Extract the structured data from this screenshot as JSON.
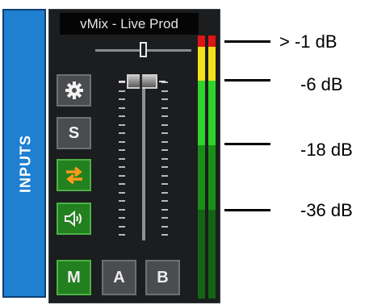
{
  "side_tab": {
    "label": "INPUTS"
  },
  "panel": {
    "title": "vMix - Live Prod",
    "buttons": {
      "settings_icon": "gear-icon",
      "solo": "S",
      "swap_icon": "swap-arrows-icon",
      "audio_icon": "speaker-icon",
      "master": "M",
      "bus_a": "A",
      "bus_b": "B"
    }
  },
  "colors": {
    "inputs_tab": "#1f7fd0",
    "panel": "#1b1d1f",
    "green_button": "#23801f",
    "gray_button": "#4a4c4f",
    "swap_arrows": "#ff9a1a",
    "meter_red": "#e11414",
    "meter_yellow": "#f2e21b",
    "meter_green": "#2fd42a",
    "meter_dark_green": "#0f3f0f"
  },
  "annotations": [
    {
      "label": "> -1 dB"
    },
    {
      "label": "-6 dB"
    },
    {
      "label": "-18 dB"
    },
    {
      "label": "-36 dB"
    }
  ]
}
